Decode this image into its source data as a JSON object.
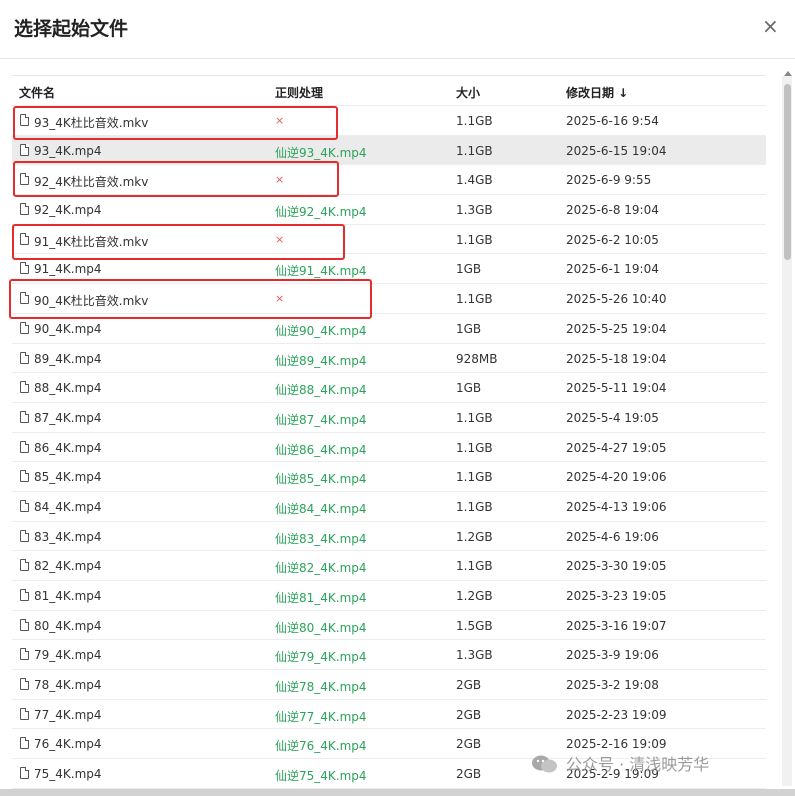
{
  "dialog": {
    "title": "选择起始文件",
    "close_glyph": "×"
  },
  "table": {
    "headers": {
      "name": "文件名",
      "rule": "正则处理",
      "size": "大小",
      "date": "修改日期 ↓"
    },
    "rows": [
      {
        "name": "93_4K杜比音效.mkv",
        "rule": "×",
        "size": "1.1GB",
        "date": "2025-6-16 9:54",
        "status": "error",
        "highlighted": false
      },
      {
        "name": "93_4K.mp4",
        "rule": "仙逆93_4K.mp4",
        "size": "1.1GB",
        "date": "2025-6-15 19:04",
        "status": "ok",
        "highlighted": true
      },
      {
        "name": "92_4K杜比音效.mkv",
        "rule": "×",
        "size": "1.4GB",
        "date": "2025-6-9 9:55",
        "status": "error",
        "highlighted": false
      },
      {
        "name": "92_4K.mp4",
        "rule": "仙逆92_4K.mp4",
        "size": "1.3GB",
        "date": "2025-6-8 19:04",
        "status": "ok",
        "highlighted": false
      },
      {
        "name": "91_4K杜比音效.mkv",
        "rule": "×",
        "size": "1.1GB",
        "date": "2025-6-2 10:05",
        "status": "error",
        "highlighted": false
      },
      {
        "name": "91_4K.mp4",
        "rule": "仙逆91_4K.mp4",
        "size": "1GB",
        "date": "2025-6-1 19:04",
        "status": "ok",
        "highlighted": false
      },
      {
        "name": "90_4K杜比音效.mkv",
        "rule": "×",
        "size": "1.1GB",
        "date": "2025-5-26 10:40",
        "status": "error",
        "highlighted": false
      },
      {
        "name": "90_4K.mp4",
        "rule": "仙逆90_4K.mp4",
        "size": "1GB",
        "date": "2025-5-25 19:04",
        "status": "ok",
        "highlighted": false
      },
      {
        "name": "89_4K.mp4",
        "rule": "仙逆89_4K.mp4",
        "size": "928MB",
        "date": "2025-5-18 19:04",
        "status": "ok",
        "highlighted": false
      },
      {
        "name": "88_4K.mp4",
        "rule": "仙逆88_4K.mp4",
        "size": "1GB",
        "date": "2025-5-11 19:04",
        "status": "ok",
        "highlighted": false
      },
      {
        "name": "87_4K.mp4",
        "rule": "仙逆87_4K.mp4",
        "size": "1.1GB",
        "date": "2025-5-4 19:05",
        "status": "ok",
        "highlighted": false
      },
      {
        "name": "86_4K.mp4",
        "rule": "仙逆86_4K.mp4",
        "size": "1.1GB",
        "date": "2025-4-27 19:05",
        "status": "ok",
        "highlighted": false
      },
      {
        "name": "85_4K.mp4",
        "rule": "仙逆85_4K.mp4",
        "size": "1.1GB",
        "date": "2025-4-20 19:06",
        "status": "ok",
        "highlighted": false
      },
      {
        "name": "84_4K.mp4",
        "rule": "仙逆84_4K.mp4",
        "size": "1.1GB",
        "date": "2025-4-13 19:06",
        "status": "ok",
        "highlighted": false
      },
      {
        "name": "83_4K.mp4",
        "rule": "仙逆83_4K.mp4",
        "size": "1.2GB",
        "date": "2025-4-6 19:06",
        "status": "ok",
        "highlighted": false
      },
      {
        "name": "82_4K.mp4",
        "rule": "仙逆82_4K.mp4",
        "size": "1.1GB",
        "date": "2025-3-30 19:05",
        "status": "ok",
        "highlighted": false
      },
      {
        "name": "81_4K.mp4",
        "rule": "仙逆81_4K.mp4",
        "size": "1.2GB",
        "date": "2025-3-23 19:05",
        "status": "ok",
        "highlighted": false
      },
      {
        "name": "80_4K.mp4",
        "rule": "仙逆80_4K.mp4",
        "size": "1.5GB",
        "date": "2025-3-16 19:07",
        "status": "ok",
        "highlighted": false
      },
      {
        "name": "79_4K.mp4",
        "rule": "仙逆79_4K.mp4",
        "size": "1.3GB",
        "date": "2025-3-9 19:06",
        "status": "ok",
        "highlighted": false
      },
      {
        "name": "78_4K.mp4",
        "rule": "仙逆78_4K.mp4",
        "size": "2GB",
        "date": "2025-3-2 19:08",
        "status": "ok",
        "highlighted": false
      },
      {
        "name": "77_4K.mp4",
        "rule": "仙逆77_4K.mp4",
        "size": "2GB",
        "date": "2025-2-23 19:09",
        "status": "ok",
        "highlighted": false
      },
      {
        "name": "76_4K.mp4",
        "rule": "仙逆76_4K.mp4",
        "size": "2GB",
        "date": "2025-2-16 19:09",
        "status": "ok",
        "highlighted": false
      },
      {
        "name": "75_4K.mp4",
        "rule": "仙逆75_4K.mp4",
        "size": "2GB",
        "date": "2025-2-9 19:09",
        "status": "ok",
        "highlighted": false
      }
    ]
  },
  "watermark": {
    "text": "公众号 · 清浅映芳华"
  },
  "colors": {
    "ok": "#2aa45a",
    "error": "#e85a5a",
    "annotation": "#e52b2b",
    "highlight": "#ebebeb"
  }
}
